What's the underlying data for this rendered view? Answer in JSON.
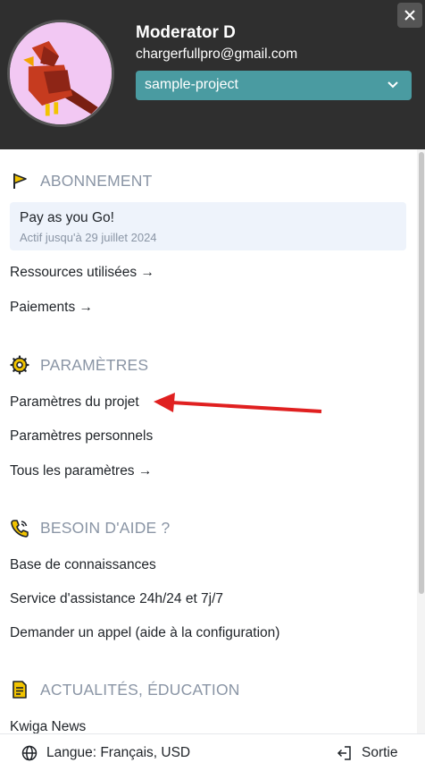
{
  "header": {
    "user_name": "Moderator D",
    "email": "chargerfullpro@gmail.com",
    "project": "sample-project"
  },
  "sections": {
    "subscription": {
      "title": "ABONNEMENT",
      "plan_name": "Pay as you Go!",
      "plan_validity": "Actif jusqu'à 29 juillet 2024",
      "links": [
        "Ressources utilisées →",
        "Paiements →"
      ]
    },
    "settings": {
      "title": "PARAMÈTRES",
      "links": [
        "Paramètres du projet",
        "Paramètres personnels",
        "Tous les paramètres →"
      ]
    },
    "help": {
      "title": "BESOIN D'AIDE ?",
      "links": [
        "Base de connaissances",
        "Service d'assistance 24h/24 et 7j/7",
        "Demander un appel (aide à la configuration)"
      ]
    },
    "news": {
      "title": "ACTUALITÉS, ÉDUCATION",
      "links": [
        "Kwiga News"
      ]
    }
  },
  "footer": {
    "language": "Langue: Français, USD",
    "exit": "Sortie"
  },
  "colors": {
    "header_bg": "#2f2f2f",
    "project_select": "#4a9ba1",
    "section_title": "#8a95a5",
    "icon_yellow": "#f2c400",
    "annotation_arrow": "#e02020"
  },
  "icons": [
    "close-icon",
    "chevron-down-icon",
    "flag-icon",
    "gear-icon",
    "phone-icon",
    "document-icon",
    "globe-icon",
    "logout-icon"
  ]
}
